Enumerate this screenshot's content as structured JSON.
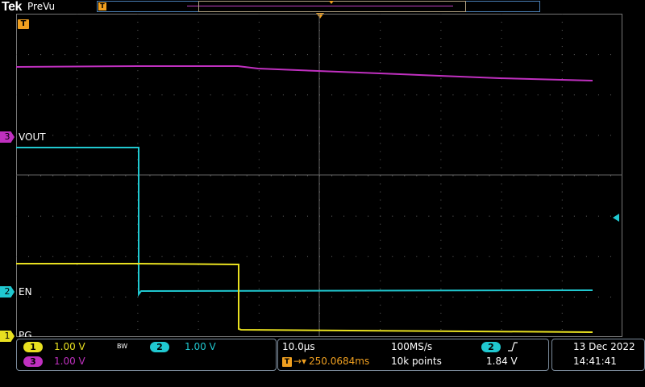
{
  "header": {
    "brand": "Tek",
    "mode": "PreVu"
  },
  "trigger_marker": "T",
  "channels": {
    "ch3": {
      "number": "3",
      "label": "VOUT",
      "scale": "1.00 V",
      "color": "#c030c0"
    },
    "ch2": {
      "number": "2",
      "label": "EN",
      "scale": "1.00 V",
      "color": "#20c8d0"
    },
    "ch1": {
      "number": "1",
      "label": "PG",
      "scale": "1.00 V",
      "color": "#e8e020"
    }
  },
  "bandwidth_limit": "BW",
  "timebase": {
    "scale": "10.0µs",
    "sample_rate": "100MS/s",
    "position": "250.0684ms",
    "record_length": "10k points"
  },
  "trigger": {
    "source": "2",
    "slope_icon": "rising-edge",
    "level": "1.84 V"
  },
  "datetime": {
    "date": "13 Dec  2022",
    "time": "14:41:41"
  },
  "icons": [
    "trigger-position-icon",
    "rising-edge-icon",
    "trigger-level-icon"
  ]
}
